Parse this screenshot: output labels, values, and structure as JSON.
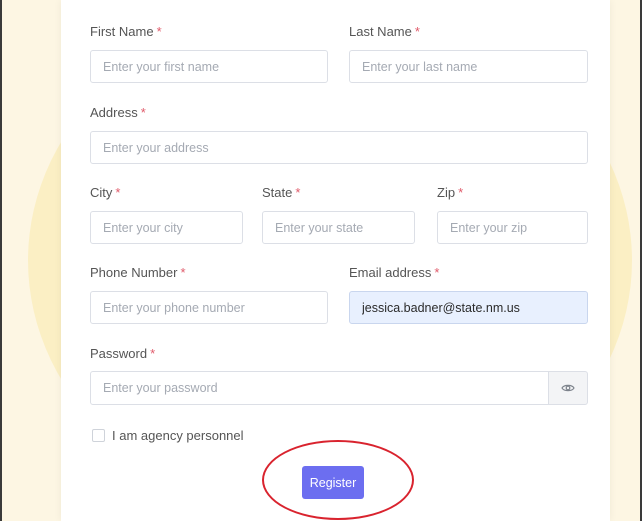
{
  "form": {
    "first_name": {
      "label": "First Name",
      "placeholder": "Enter your first name",
      "value": ""
    },
    "last_name": {
      "label": "Last Name",
      "placeholder": "Enter your last name",
      "value": ""
    },
    "address": {
      "label": "Address",
      "placeholder": "Enter your address",
      "value": ""
    },
    "city": {
      "label": "City",
      "placeholder": "Enter your city",
      "value": ""
    },
    "state": {
      "label": "State",
      "placeholder": "Enter your state",
      "value": ""
    },
    "zip": {
      "label": "Zip",
      "placeholder": "Enter your zip",
      "value": ""
    },
    "phone": {
      "label": "Phone Number",
      "placeholder": "Enter your phone number",
      "value": ""
    },
    "email": {
      "label": "Email address",
      "placeholder": "",
      "value": "jessica.badner@state.nm.us"
    },
    "password": {
      "label": "Password",
      "placeholder": "Enter your password",
      "value": ""
    },
    "required_marker": "*",
    "agency_checkbox": {
      "label": "I am agency personnel",
      "checked": false
    },
    "register_label": "Register"
  },
  "icons": {
    "password_toggle": "eye-icon"
  },
  "colors": {
    "accent": "#6c6ef0",
    "required": "#e05a6a",
    "annotation": "#d9232e",
    "autofill": "#e8f0fe"
  }
}
